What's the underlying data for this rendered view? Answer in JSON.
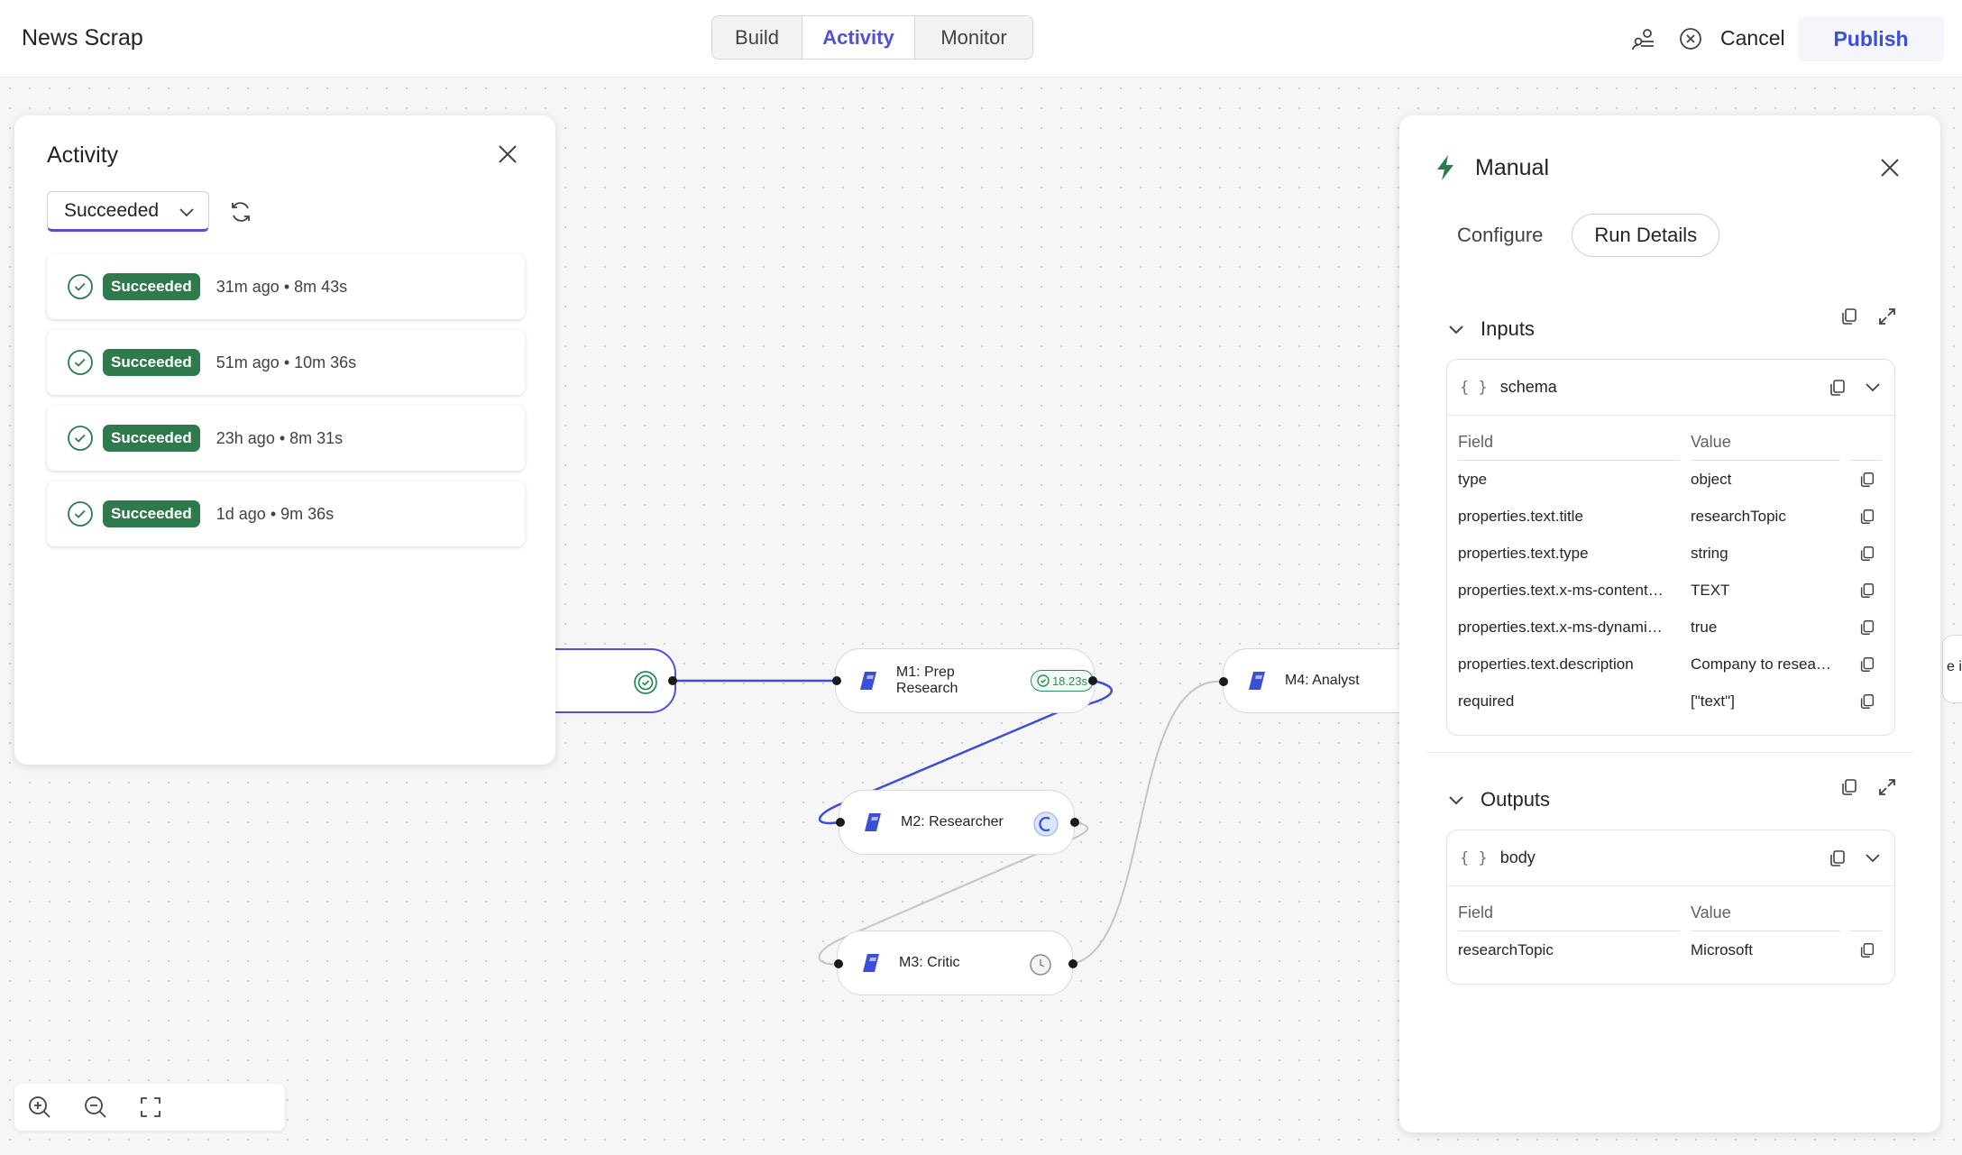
{
  "app": {
    "title": "News Scrap"
  },
  "header": {
    "tabs": [
      {
        "label": "Build",
        "active": false
      },
      {
        "label": "Activity",
        "active": true
      },
      {
        "label": "Monitor",
        "active": false
      }
    ],
    "cancel_label": "Cancel",
    "publish_label": "Publish"
  },
  "activity": {
    "title": "Activity",
    "filter_value": "Succeeded",
    "runs": [
      {
        "status": "Succeeded",
        "meta": "31m ago • 8m 43s"
      },
      {
        "status": "Succeeded",
        "meta": "51m ago • 10m 36s"
      },
      {
        "status": "Succeeded",
        "meta": "23h ago • 8m 31s"
      },
      {
        "status": "Succeeded",
        "meta": "1d ago • 9m 36s"
      }
    ]
  },
  "flow": {
    "nodes": [
      {
        "label": "M1: Prep Research",
        "badge": "18.23s",
        "state": "succeeded"
      },
      {
        "label": "M2: Researcher",
        "state": "running"
      },
      {
        "label": "M3: Critic",
        "state": "pending"
      },
      {
        "label": "M4: Analyst",
        "state": "none"
      }
    ],
    "peek_label": "e it"
  },
  "details": {
    "title": "Manual",
    "tabs": [
      {
        "label": "Configure",
        "active": false
      },
      {
        "label": "Run Details",
        "active": true
      }
    ],
    "inputs": {
      "title": "Inputs",
      "object_name": "schema",
      "col_field": "Field",
      "col_value": "Value",
      "rows": [
        {
          "field": "type",
          "value": "object"
        },
        {
          "field": "properties.text.title",
          "value": "researchTopic"
        },
        {
          "field": "properties.text.type",
          "value": "string"
        },
        {
          "field": "properties.text.x-ms-content…",
          "value": "TEXT"
        },
        {
          "field": "properties.text.x-ms-dynami…",
          "value": "true"
        },
        {
          "field": "properties.text.description",
          "value": "Company to resea…"
        },
        {
          "field": "required",
          "value": "[\"text\"]"
        }
      ]
    },
    "outputs": {
      "title": "Outputs",
      "object_name": "body",
      "col_field": "Field",
      "col_value": "Value",
      "rows": [
        {
          "field": "researchTopic",
          "value": "Microsoft"
        }
      ]
    }
  },
  "colors": {
    "accent": "#4f52d8",
    "success": "#2f7a4d",
    "edge_active": "#3b4fd6",
    "edge_idle": "#c4c4c4"
  }
}
